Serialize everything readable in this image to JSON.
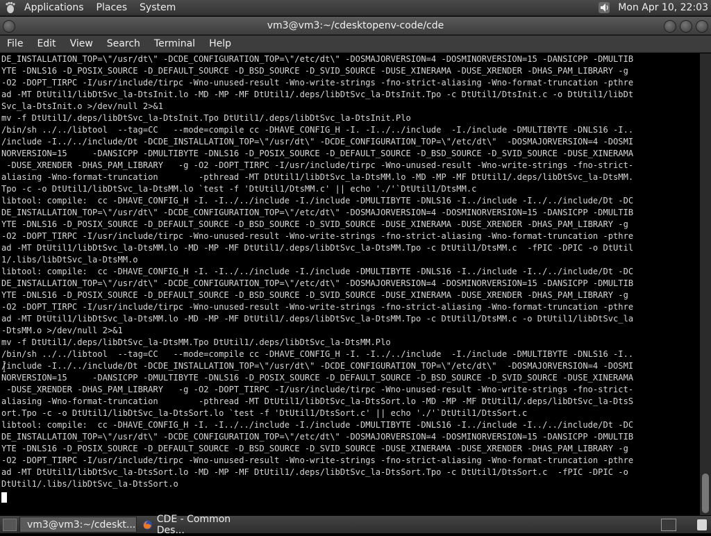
{
  "top_panel": {
    "menus": [
      "Applications",
      "Places",
      "System"
    ],
    "clock": "Mon Apr 10, 22:03"
  },
  "window": {
    "title": "vm3@vm3:~/cdesktopenv-code/cde"
  },
  "menubar": [
    "File",
    "Edit",
    "View",
    "Search",
    "Terminal",
    "Help"
  ],
  "terminal": {
    "lines": [
      "DE_INSTALLATION_TOP=\\\"/usr/dt\\\" -DCDE_CONFIGURATION_TOP=\\\"/etc/dt\\\" -DOSMAJORVERSION=4 -DOSMINORVERSION=15 -DANSICPP -DMULTIB",
      "YTE -DNLS16 -D_POSIX_SOURCE -D_DEFAULT_SOURCE -D_BSD_SOURCE -D_SVID_SOURCE -DUSE_XINERAMA -DUSE_XRENDER -DHAS_PAM_LIBRARY -g",
      "-O2 -DOPT_TIRPC -I/usr/include/tirpc -Wno-unused-result -Wno-write-strings -fno-strict-aliasing -Wno-format-truncation -pthre",
      "ad -MT DtUtil1/libDtSvc_la-DtsInit.lo -MD -MP -MF DtUtil1/.deps/libDtSvc_la-DtsInit.Tpo -c DtUtil1/DtsInit.c -o DtUtil1/libDt",
      "Svc_la-DtsInit.o >/dev/null 2>&1",
      "mv -f DtUtil1/.deps/libDtSvc_la-DtsInit.Tpo DtUtil1/.deps/libDtSvc_la-DtsInit.Plo",
      "/bin/sh ../../libtool  --tag=CC   --mode=compile cc -DHAVE_CONFIG_H -I. -I../../include  -I./include -DMULTIBYTE -DNLS16 -I..",
      "/include -I../../include/Dt -DCDE_INSTALLATION_TOP=\\\"/usr/dt\\\" -DCDE_CONFIGURATION_TOP=\\\"/etc/dt\\\"  -DOSMAJORVERSION=4 -DOSMI",
      "NORVERSION=15     -DANSICPP -DMULTIBYTE -DNLS16 -D_POSIX_SOURCE -D_DEFAULT_SOURCE -D_BSD_SOURCE -D_SVID_SOURCE -DUSE_XINERAMA",
      " -DUSE_XRENDER -DHAS_PAM_LIBRARY   -g -O2 -DOPT_TIRPC -I/usr/include/tirpc -Wno-unused-result -Wno-write-strings -fno-strict-",
      "aliasing -Wno-format-truncation        -pthread -MT DtUtil1/libDtSvc_la-DtsMM.lo -MD -MP -MF DtUtil1/.deps/libDtSvc_la-DtsMM.",
      "Tpo -c -o DtUtil1/libDtSvc_la-DtsMM.lo `test -f 'DtUtil1/DtsMM.c' || echo './'`DtUtil1/DtsMM.c",
      "libtool: compile:  cc -DHAVE_CONFIG_H -I. -I../../include -I./include -DMULTIBYTE -DNLS16 -I../include -I../../include/Dt -DC",
      "DE_INSTALLATION_TOP=\\\"/usr/dt\\\" -DCDE_CONFIGURATION_TOP=\\\"/etc/dt\\\" -DOSMAJORVERSION=4 -DOSMINORVERSION=15 -DANSICPP -DMULTIB",
      "YTE -DNLS16 -D_POSIX_SOURCE -D_DEFAULT_SOURCE -D_BSD_SOURCE -D_SVID_SOURCE -DUSE_XINERAMA -DUSE_XRENDER -DHAS_PAM_LIBRARY -g",
      "-O2 -DOPT_TIRPC -I/usr/include/tirpc -Wno-unused-result -Wno-write-strings -fno-strict-aliasing -Wno-format-truncation -pthre",
      "ad -MT DtUtil1/libDtSvc_la-DtsMM.lo -MD -MP -MF DtUtil1/.deps/libDtSvc_la-DtsMM.Tpo -c DtUtil1/DtsMM.c  -fPIC -DPIC -o DtUtil",
      "1/.libs/libDtSvc_la-DtsMM.o",
      "libtool: compile:  cc -DHAVE_CONFIG_H -I. -I../../include -I./include -DMULTIBYTE -DNLS16 -I../include -I../../include/Dt -DC",
      "DE_INSTALLATION_TOP=\\\"/usr/dt\\\" -DCDE_CONFIGURATION_TOP=\\\"/etc/dt\\\" -DOSMAJORVERSION=4 -DOSMINORVERSION=15 -DANSICPP -DMULTIB",
      "YTE -DNLS16 -D_POSIX_SOURCE -D_DEFAULT_SOURCE -D_BSD_SOURCE -D_SVID_SOURCE -DUSE_XINERAMA -DUSE_XRENDER -DHAS_PAM_LIBRARY -g",
      "-O2 -DOPT_TIRPC -I/usr/include/tirpc -Wno-unused-result -Wno-write-strings -fno-strict-aliasing -Wno-format-truncation -pthre",
      "ad -MT DtUtil1/libDtSvc_la-DtsMM.lo -MD -MP -MF DtUtil1/.deps/libDtSvc_la-DtsMM.Tpo -c DtUtil1/DtsMM.c -o DtUtil1/libDtSvc_la",
      "-DtsMM.o >/dev/null 2>&1",
      "mv -f DtUtil1/.deps/libDtSvc_la-DtsMM.Tpo DtUtil1/.deps/libDtSvc_la-DtsMM.Plo",
      "/bin/sh ../../libtool  --tag=CC   --mode=compile cc -DHAVE_CONFIG_H -I. -I../../include  -I./include -DMULTIBYTE -DNLS16 -I..",
      "/include -I../../include/Dt -DCDE_INSTALLATION_TOP=\\\"/usr/dt\\\" -DCDE_CONFIGURATION_TOP=\\\"/etc/dt\\\"  -DOSMAJORVERSION=4 -DOSMI",
      "NORVERSION=15     -DANSICPP -DMULTIBYTE -DNLS16 -D_POSIX_SOURCE -D_DEFAULT_SOURCE -D_BSD_SOURCE -D_SVID_SOURCE -DUSE_XINERAMA",
      " -DUSE_XRENDER -DHAS_PAM_LIBRARY   -g -O2 -DOPT_TIRPC -I/usr/include/tirpc -Wno-unused-result -Wno-write-strings -fno-strict-",
      "aliasing -Wno-format-truncation        -pthread -MT DtUtil1/libDtSvc_la-DtsSort.lo -MD -MP -MF DtUtil1/.deps/libDtSvc_la-DtsS",
      "ort.Tpo -c -o DtUtil1/libDtSvc_la-DtsSort.lo `test -f 'DtUtil1/DtsSort.c' || echo './'`DtUtil1/DtsSort.c",
      "libtool: compile:  cc -DHAVE_CONFIG_H -I. -I../../include -I./include -DMULTIBYTE -DNLS16 -I../include -I../../include/Dt -DC",
      "DE_INSTALLATION_TOP=\\\"/usr/dt\\\" -DCDE_CONFIGURATION_TOP=\\\"/etc/dt\\\" -DOSMAJORVERSION=4 -DOSMINORVERSION=15 -DANSICPP -DMULTIB",
      "YTE -DNLS16 -D_POSIX_SOURCE -D_DEFAULT_SOURCE -D_BSD_SOURCE -D_SVID_SOURCE -DUSE_XINERAMA -DUSE_XRENDER -DHAS_PAM_LIBRARY -g",
      "-O2 -DOPT_TIRPC -I/usr/include/tirpc -Wno-unused-result -Wno-write-strings -fno-strict-aliasing -Wno-format-truncation -pthre",
      "ad -MT DtUtil1/libDtSvc_la-DtsSort.lo -MD -MP -MF DtUtil1/.deps/libDtSvc_la-DtsSort.Tpo -c DtUtil1/DtsSort.c  -fPIC -DPIC -o",
      "DtUtil1/.libs/libDtSvc_la-DtsSort.o"
    ]
  },
  "taskbar": {
    "tasks": [
      {
        "label": "vm3@vm3:~/cdeskt...",
        "icon": "terminal-icon"
      },
      {
        "label": "CDE - Common Des...",
        "icon": "firefox-icon"
      }
    ]
  },
  "colors": {
    "panel": "#3a3a3a",
    "terminal_bg": "#000000",
    "terminal_fg": "#d7d7d7"
  }
}
